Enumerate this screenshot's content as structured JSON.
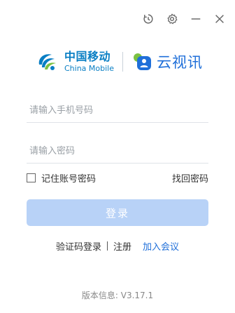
{
  "titlebar": {
    "icons": [
      "history-icon",
      "settings-gear-icon",
      "minimize-icon",
      "close-icon"
    ]
  },
  "brand": {
    "operator_cn": "中国移动",
    "operator_en": "China Mobile",
    "product_name": "云视讯",
    "colors": {
      "operator_blue": "#0a7fc4",
      "product_blue": "#1f6fd9",
      "product_green": "#7cc142"
    }
  },
  "login": {
    "phone_placeholder": "请输入手机号码",
    "phone_value": "",
    "password_placeholder": "请输入密码",
    "password_value": "",
    "remember_label": "记住账号密码",
    "remember_checked": false,
    "forgot_label": "找回密码",
    "submit_label": "登录",
    "submit_color": "#b8d2f7"
  },
  "links": {
    "sms_login": "验证码登录",
    "register": "注册",
    "join_meeting": "加入会议"
  },
  "footer": {
    "version": "版本信息: V3.17.1"
  }
}
